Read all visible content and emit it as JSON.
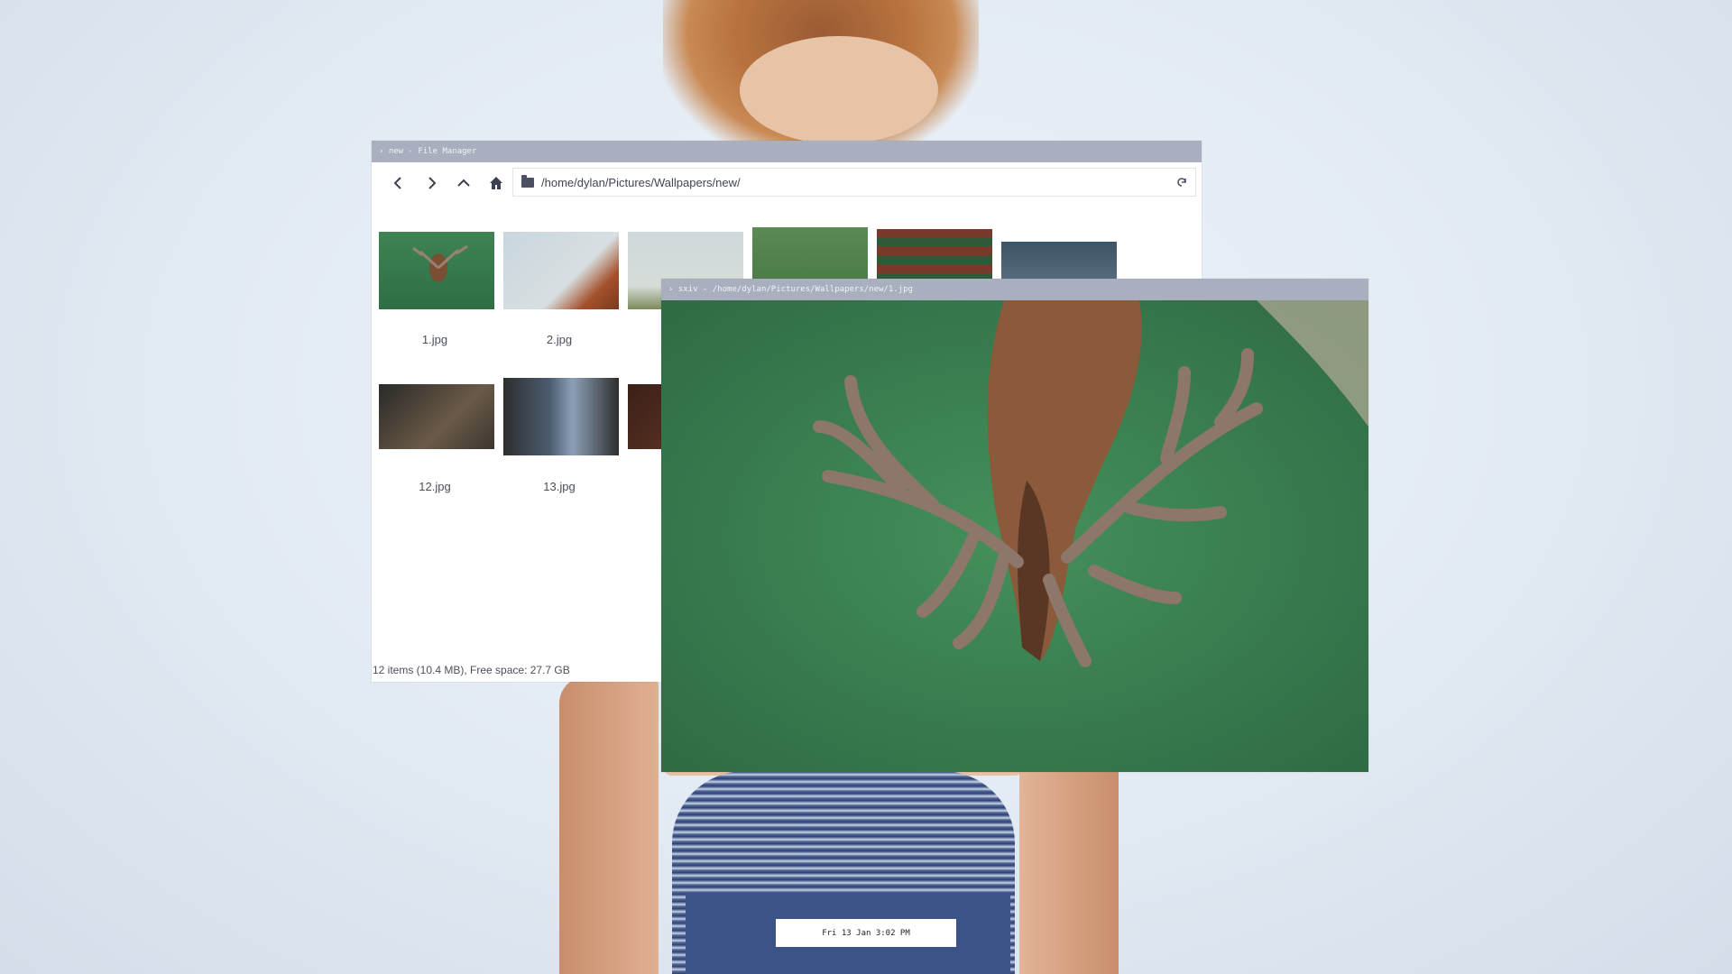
{
  "file_manager": {
    "title": "› new - File Manager",
    "path": "/home/dylan/Pictures/Wallpapers/new/",
    "status": "12 items (10.4 MB), Free space: 27.7 GB",
    "files": [
      {
        "name": "1.jpg"
      },
      {
        "name": "2.jpg"
      },
      {
        "name": ""
      },
      {
        "name": ""
      },
      {
        "name": ""
      },
      {
        "name": ""
      },
      {
        "name": "12.jpg"
      },
      {
        "name": "13.jpg"
      },
      {
        "name": ""
      }
    ],
    "icons": [
      "back-icon",
      "forward-icon",
      "up-icon",
      "home-icon",
      "folder-icon",
      "refresh-icon"
    ]
  },
  "sxiv": {
    "title": "› sxiv - /home/dylan/Pictures/Wallpapers/new/1.jpg"
  },
  "clock": {
    "text": "Fri 13 Jan  3:02 PM"
  },
  "colors": {
    "titlebar": "#a9afbf",
    "grass": "#3a7f51",
    "deer": "#8a5a3a"
  }
}
